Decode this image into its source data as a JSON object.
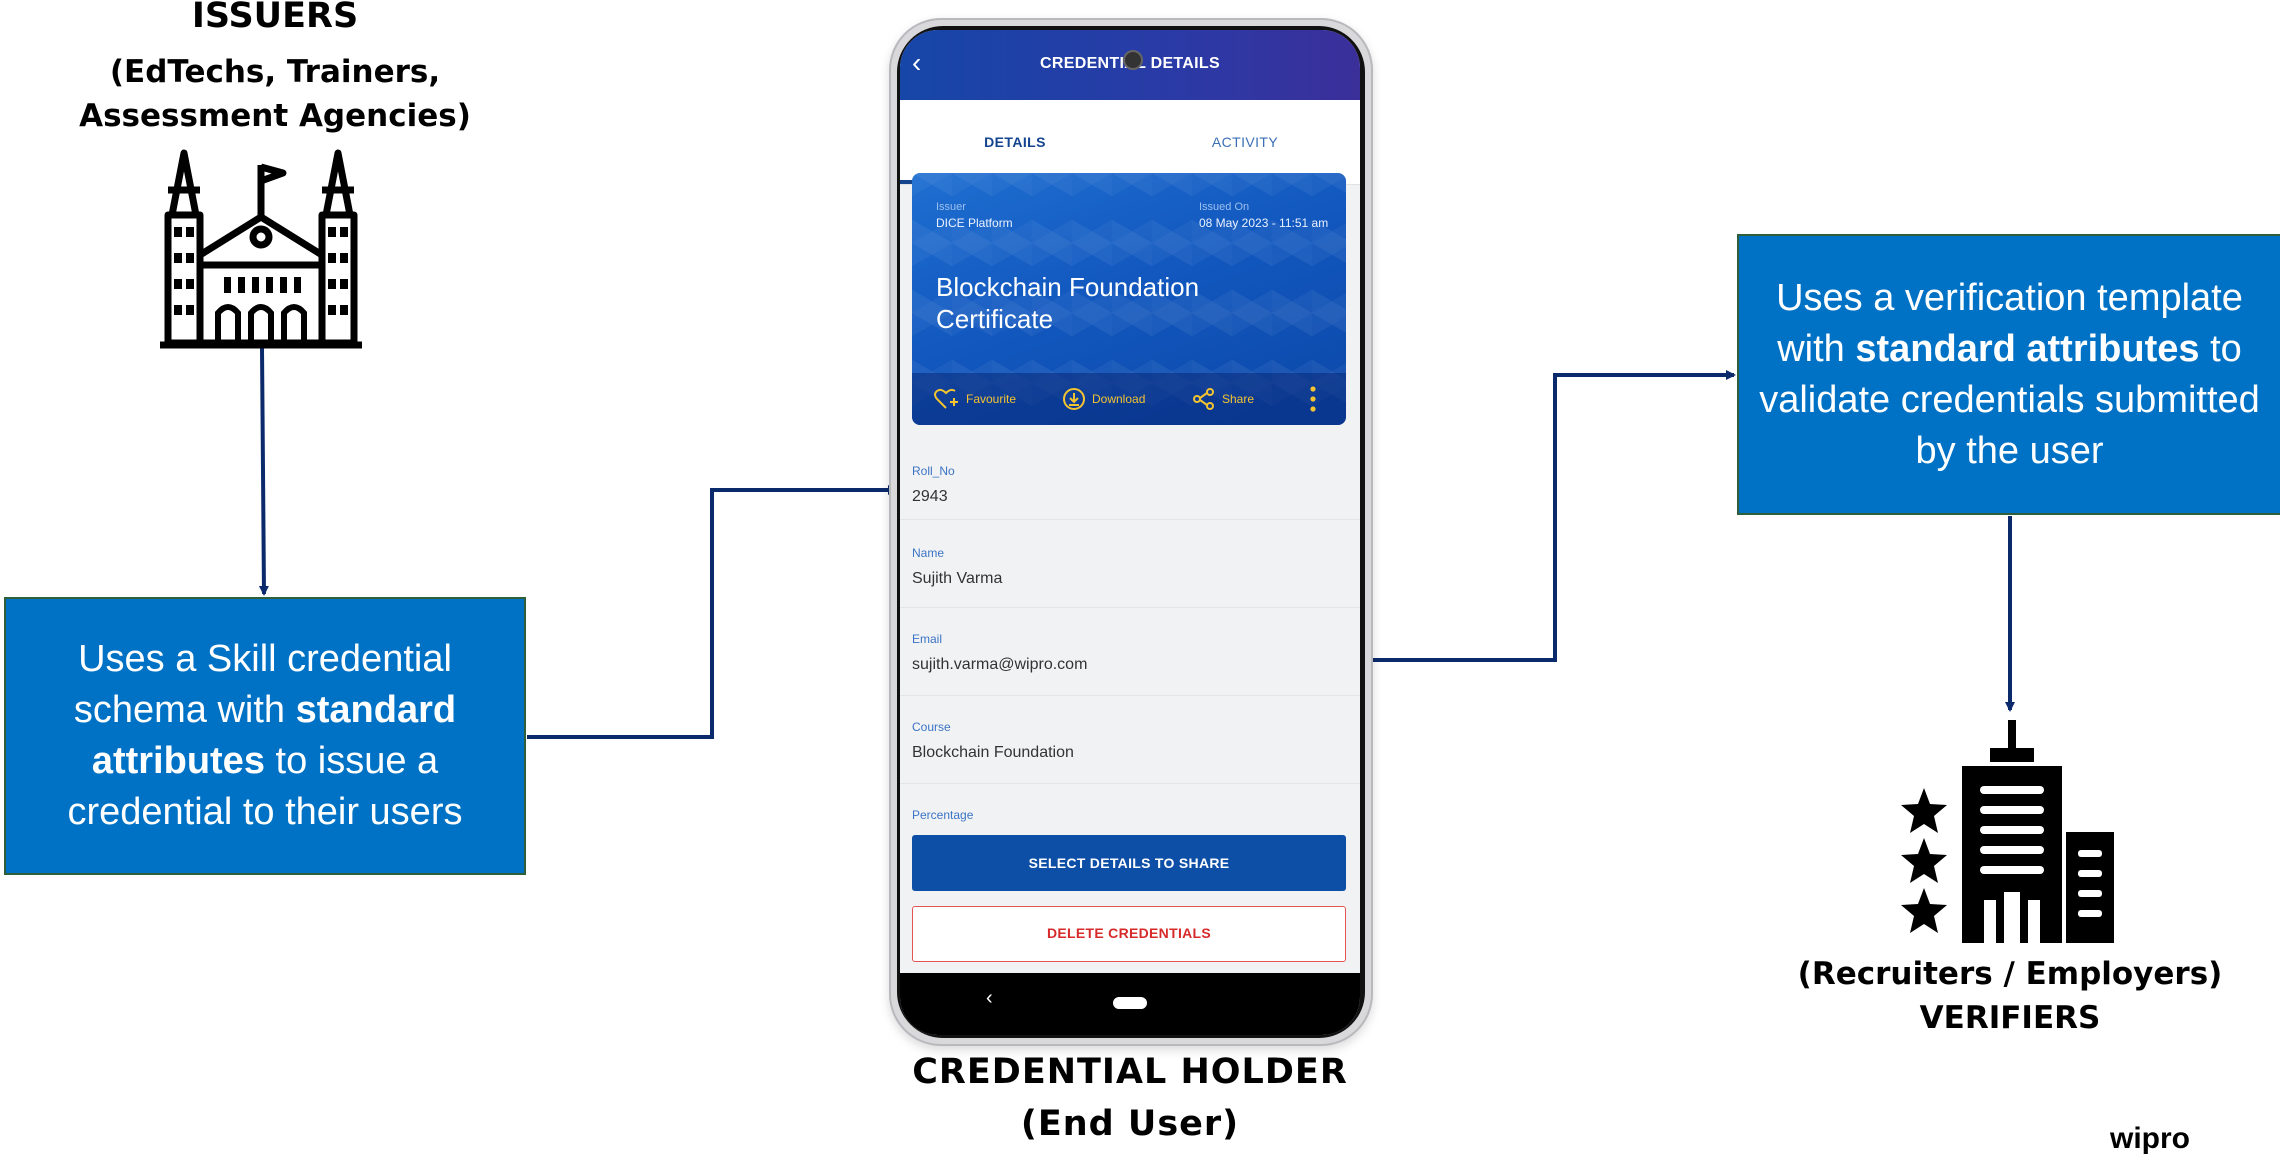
{
  "issuers": {
    "title": "ISSUERS",
    "subtitle_line1": "(EdTechs, Trainers,",
    "subtitle_line2": "Assessment Agencies)",
    "box": {
      "text1": "Uses a Skill credential schema with ",
      "bold1": "standard attributes",
      "text2": " to issue a credential to their users"
    }
  },
  "verifiers": {
    "box": {
      "text1": "Uses a verification template with ",
      "bold1": "standard attributes",
      "text2": "  to validate credentials submitted by the user"
    },
    "label_line1": "(Recruiters / Employers)",
    "label_line2": "VERIFIERS"
  },
  "holder": {
    "label_line1": "CREDENTIAL HOLDER",
    "label_line2": "(End User)"
  },
  "brand": "wipro",
  "phone": {
    "app_title": "CREDENTIAL DETAILS",
    "tabs": [
      "DETAILS",
      "ACTIVITY"
    ],
    "card": {
      "issuer_label": "Issuer",
      "issuer_value": "DICE Platform",
      "issued_label": "Issued On",
      "issued_value": "08 May 2023 - 11:51 am",
      "title": "Blockchain Foundation Certificate",
      "actions": [
        "Favourite",
        "Download",
        "Share"
      ]
    },
    "fields": [
      {
        "label": "Roll_No",
        "value": "2943"
      },
      {
        "label": "Name",
        "value": "Sujith Varma"
      },
      {
        "label": "Email",
        "value": "sujith.varma@wipro.com"
      },
      {
        "label": "Course",
        "value": "Blockchain Foundation"
      },
      {
        "label": "Percentage",
        "value": ""
      }
    ],
    "share_button": "SELECT DETAILS TO SHARE",
    "delete_button": "DELETE CREDENTIALS"
  },
  "colors": {
    "box_blue": "#0072c6",
    "arrow": "#0b2a6b",
    "app_bar": "#1646a8",
    "delete_red": "#d72b2b"
  },
  "icons": {
    "issuer": "institution-building-icon",
    "verifier": "office-building-stars-icon"
  }
}
